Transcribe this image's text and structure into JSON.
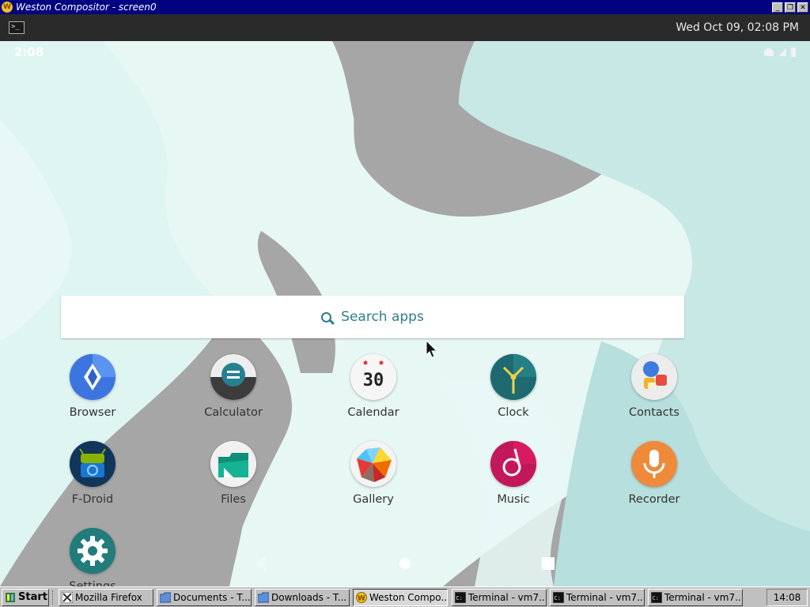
{
  "window": {
    "title": "Weston Compositor - screen0",
    "minimize": "_",
    "maximize": "❐",
    "close": "✕"
  },
  "weston_panel": {
    "launcher_glyph": ">_",
    "datetime": "Wed Oct 09, 02:08 PM"
  },
  "android": {
    "status_time": "2:08",
    "search_placeholder": "Search apps",
    "apps": [
      {
        "label": "Browser",
        "icon": "browser-icon"
      },
      {
        "label": "Calculator",
        "icon": "calculator-icon"
      },
      {
        "label": "Calendar",
        "icon": "calendar-icon",
        "badge": "30"
      },
      {
        "label": "Clock",
        "icon": "clock-icon"
      },
      {
        "label": "Contacts",
        "icon": "contacts-icon"
      },
      {
        "label": "F-Droid",
        "icon": "fdroid-icon"
      },
      {
        "label": "Files",
        "icon": "files-icon"
      },
      {
        "label": "Gallery",
        "icon": "gallery-icon"
      },
      {
        "label": "Music",
        "icon": "music-icon"
      },
      {
        "label": "Recorder",
        "icon": "recorder-icon"
      },
      {
        "label": "Settings",
        "icon": "settings-icon"
      }
    ]
  },
  "taskbar": {
    "start_label": "Start",
    "tasks": [
      {
        "label": "Mozilla Firefox",
        "icon": "firefox-icon"
      },
      {
        "label": "Documents - T...",
        "icon": "folder-icon"
      },
      {
        "label": "Downloads - T...",
        "icon": "folder-icon"
      },
      {
        "label": "Weston Compo...",
        "icon": "weston-icon",
        "active": true
      },
      {
        "label": "Terminal - vm7...",
        "icon": "terminal-icon"
      },
      {
        "label": "Terminal - vm7...",
        "icon": "terminal-icon"
      },
      {
        "label": "Terminal - vm7...",
        "icon": "terminal-icon"
      }
    ],
    "tray_clock": "14:08"
  },
  "colors": {
    "titlebar": "#000080",
    "search_accent": "#2e7d8c",
    "wallpaper_light": "#dff5f2",
    "wallpaper_gray": "#a6a6a6"
  }
}
